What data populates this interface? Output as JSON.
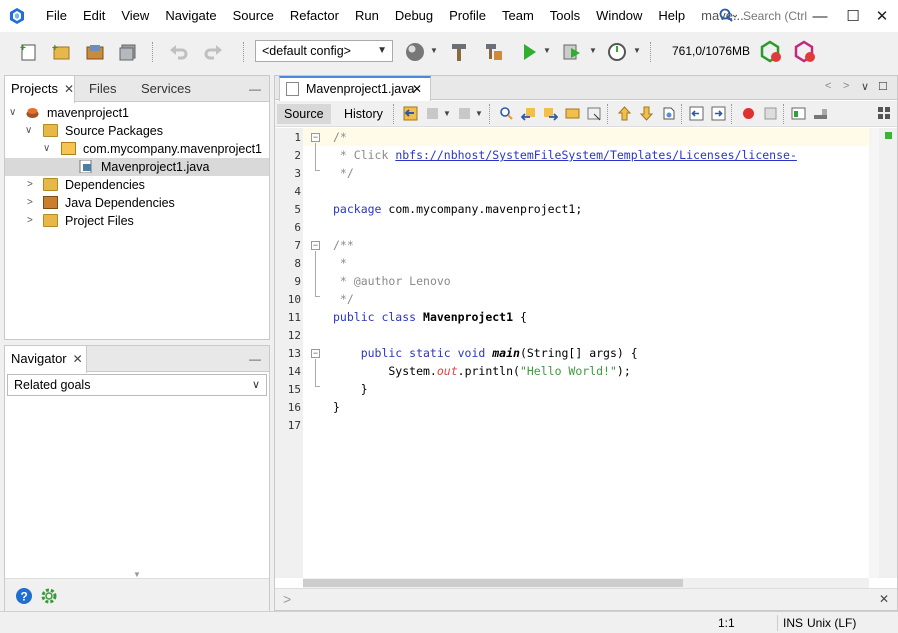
{
  "menubar": {
    "items": [
      "File",
      "Edit",
      "View",
      "Navigate",
      "Source",
      "Refactor",
      "Run",
      "Debug",
      "Profile",
      "Team",
      "Tools",
      "Window",
      "Help"
    ],
    "project_short": "mave...",
    "search_placeholder": "Search (Ctrl"
  },
  "toolbar": {
    "config": "<default config>",
    "memory": "761,0/1076MB"
  },
  "projects_pane": {
    "tabs": [
      "Projects",
      "Files",
      "Services"
    ],
    "tree": [
      {
        "label": "mavenproject1",
        "level": 0,
        "expanded": true,
        "icon": "maven-project-icon"
      },
      {
        "label": "Source Packages",
        "level": 1,
        "expanded": true,
        "icon": "folder-icon"
      },
      {
        "label": "com.mycompany.mavenproject1",
        "level": 2,
        "expanded": true,
        "icon": "package-icon"
      },
      {
        "label": "Mavenproject1.java",
        "level": 3,
        "expanded": null,
        "icon": "java-file-icon",
        "selected": true
      },
      {
        "label": "Dependencies",
        "level": 1,
        "expanded": false,
        "icon": "folder-icon"
      },
      {
        "label": "Java Dependencies",
        "level": 1,
        "expanded": false,
        "icon": "library-icon"
      },
      {
        "label": "Project Files",
        "level": 1,
        "expanded": false,
        "icon": "folder-icon"
      }
    ]
  },
  "navigator_pane": {
    "title": "Navigator",
    "select_value": "Related goals"
  },
  "editor": {
    "tab_label": "Mavenproject1.java",
    "source_label": "Source",
    "history_label": "History",
    "line_numbers": [
      "1",
      "2",
      "3",
      "4",
      "5",
      "6",
      "7",
      "8",
      "9",
      "10",
      "11",
      "12",
      "13",
      "14",
      "15",
      "16",
      "17"
    ],
    "lines": {
      "l1": "/*",
      "l2a": " * Click ",
      "l2b": "nbfs://nbhost/SystemFileSystem/Templates/Licenses/license-",
      "l3": " */",
      "l5a": "package",
      "l5b": " com.mycompany.mavenproject1;",
      "l7": "/**",
      "l8": " *",
      "l9a": " * ",
      "l9b": "@author",
      "l9c": " Lenovo",
      "l10": " */",
      "l11a": "public class",
      "l11b": " Mavenproject1",
      "l11c": " {",
      "l13a": "    public static void",
      "l13b": " main",
      "l13c": "(String[] args) {",
      "l14a": "        System.",
      "l14b": "out",
      "l14c": ".println(",
      "l14d": "\"Hello World!\"",
      "l14e": ");",
      "l15": "    }",
      "l16": "}"
    }
  },
  "statusbar": {
    "position": "1:1",
    "mode": "INS",
    "line_ending": "Unix (LF)"
  },
  "colors": {
    "keyword": "#2a35c7",
    "comment": "#8a8a8a",
    "string": "#3e9a3e",
    "tab_accent": "#4a89dc"
  }
}
